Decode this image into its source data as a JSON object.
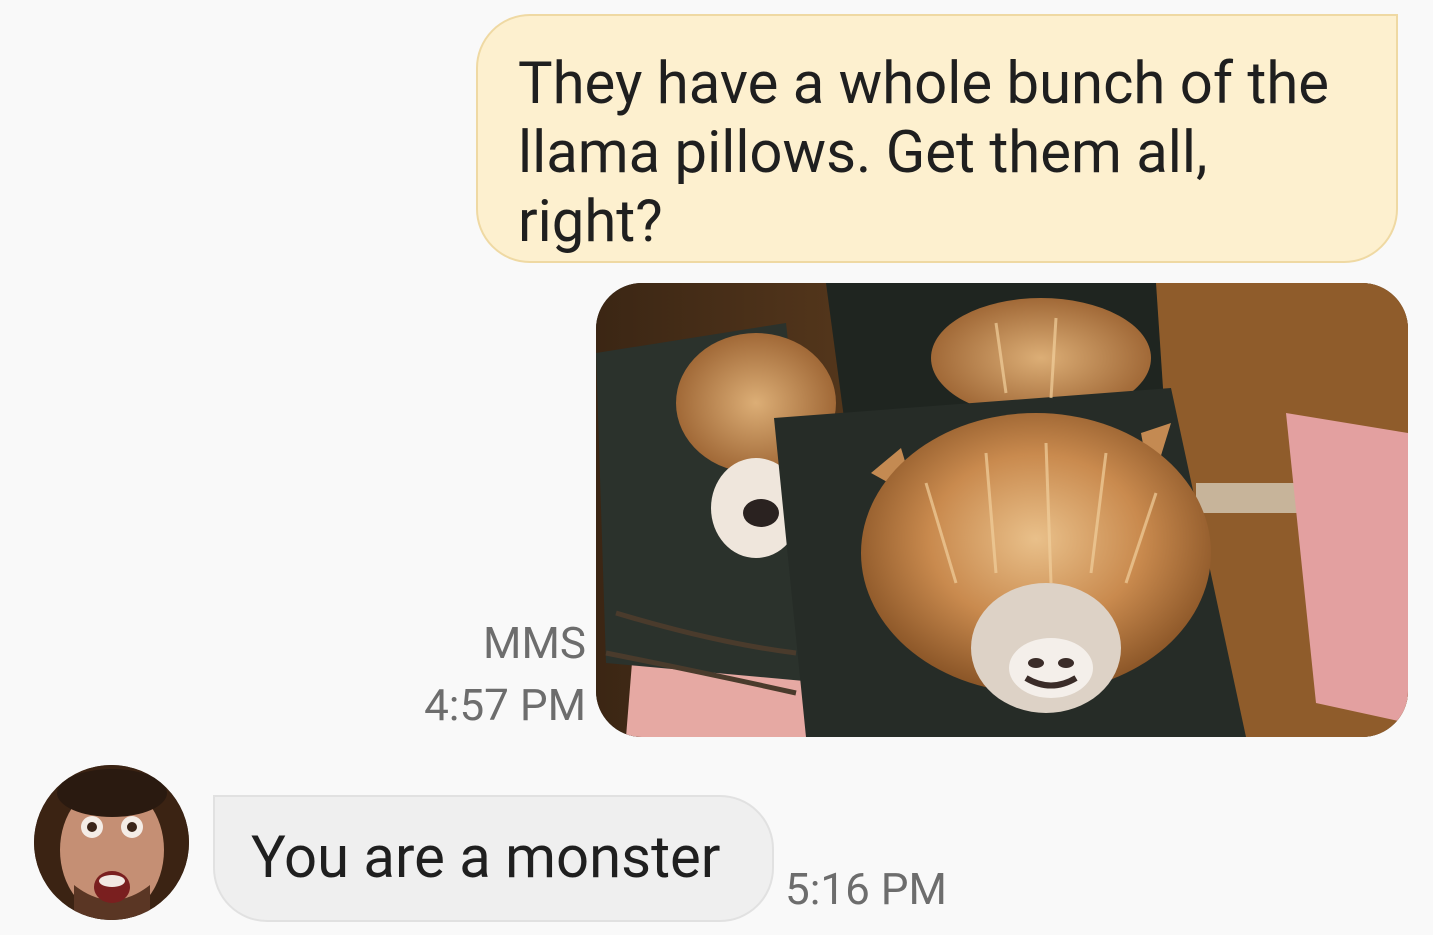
{
  "conversation": {
    "messages": [
      {
        "direction": "outgoing",
        "type": "text",
        "text": "They have a whole bunch of the llama pillows. Get them all, right?"
      },
      {
        "direction": "outgoing",
        "type": "mms",
        "label": "MMS",
        "timestamp": "4:57 PM",
        "image_description": "llama-pillows-photo"
      },
      {
        "direction": "incoming",
        "type": "text",
        "text": "You are a monster",
        "timestamp": "5:16 PM",
        "avatar": "contact-avatar-photo"
      }
    ]
  },
  "colors": {
    "outgoing_bubble": "#fdf0cf",
    "outgoing_border": "#efd9a3",
    "incoming_bubble": "#efefef",
    "background": "#f9f9f9",
    "meta_text": "#6d6d6d"
  }
}
